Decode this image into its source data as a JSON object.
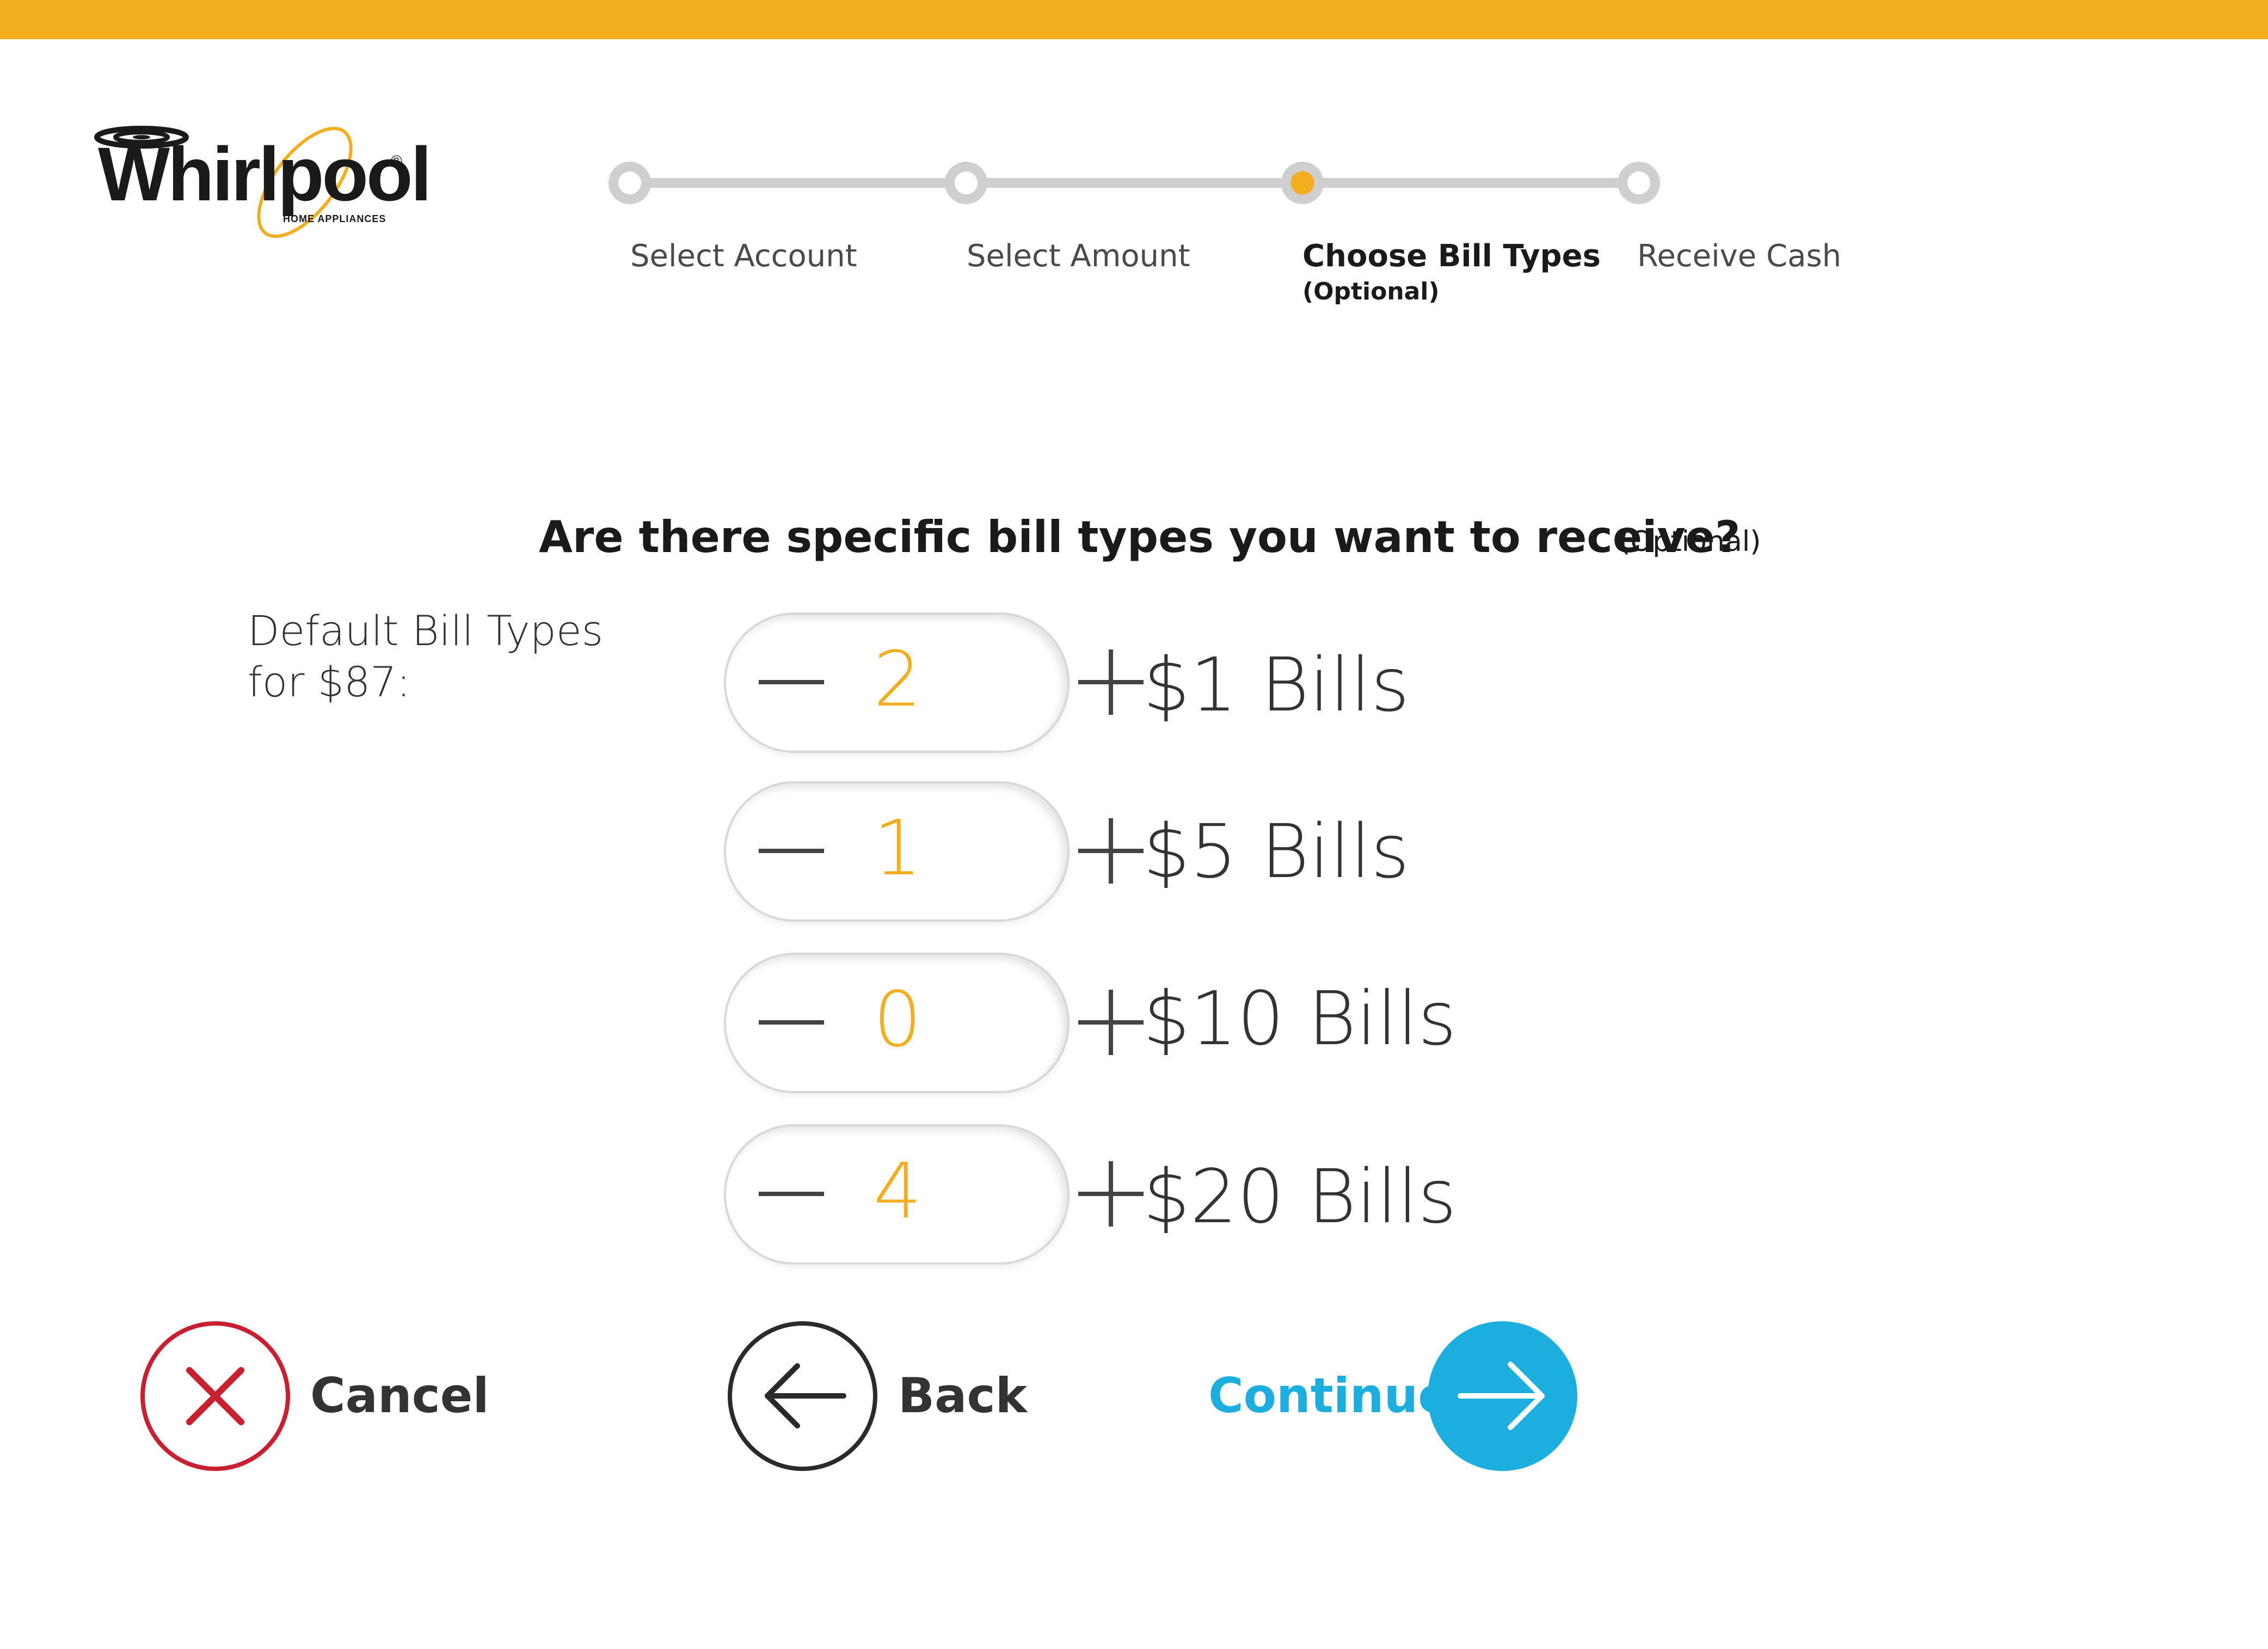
{
  "brand": {
    "name": "Whirlpool",
    "registered_mark": "®",
    "tagline": "HOME APPLIANCES",
    "accent_color": "#F2AE1E"
  },
  "progress": {
    "steps": [
      {
        "label": "Select Account",
        "sub": "",
        "state": "pending"
      },
      {
        "label": "Select Amount",
        "sub": "",
        "state": "pending"
      },
      {
        "label": "Choose Bill Types",
        "sub": "(Optional)",
        "state": "active"
      },
      {
        "label": "Receive Cash",
        "sub": "",
        "state": "pending"
      }
    ]
  },
  "question": {
    "text": "Are there specific bill types you want to receive?",
    "optional": "(Optional)"
  },
  "defaults": {
    "line1": "Default Bill Types",
    "line2": "for $87:"
  },
  "bills": [
    {
      "count": "2",
      "label": "$1 Bills"
    },
    {
      "count": "1",
      "label": "$5 Bills"
    },
    {
      "count": "0",
      "label": "$10 Bills"
    },
    {
      "count": "4",
      "label": "$20 Bills"
    }
  ],
  "actions": {
    "cancel": "Cancel",
    "back": "Back",
    "continue": "Continue",
    "cancel_color": "#C8202E",
    "continue_color": "#1BAEDE"
  }
}
